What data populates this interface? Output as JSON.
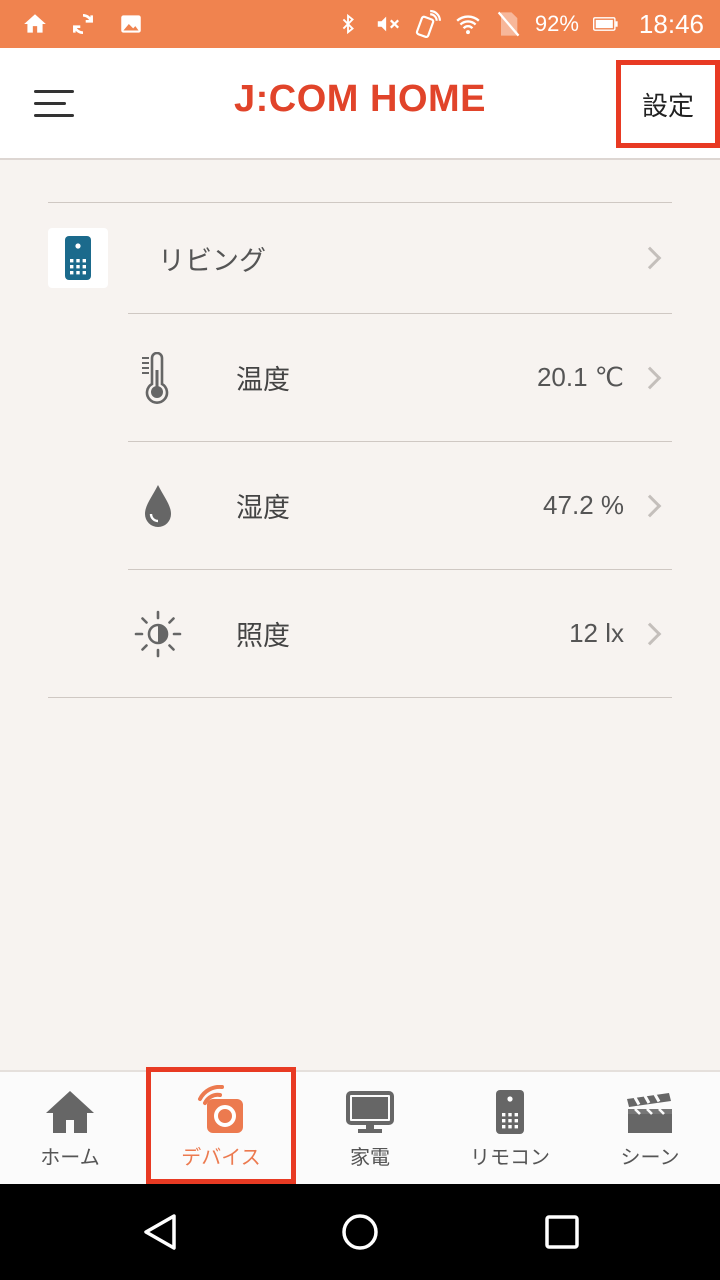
{
  "status_bar": {
    "battery": "92%",
    "time": "18:46"
  },
  "app_bar": {
    "title": "J:COM HOME",
    "settings_label": "設定"
  },
  "room": {
    "name": "リビング",
    "icon": "remote-device-icon"
  },
  "sensors": [
    {
      "label": "温度",
      "value": "20.1 ℃",
      "icon": "thermometer-icon"
    },
    {
      "label": "湿度",
      "value": "47.2 %",
      "icon": "water-drop-icon"
    },
    {
      "label": "照度",
      "value": "12 lx",
      "icon": "brightness-icon"
    }
  ],
  "bottom_nav": {
    "active": "devices",
    "items": [
      {
        "label": "ホーム",
        "icon": "home-icon"
      },
      {
        "label": "デバイス",
        "icon": "device-icon"
      },
      {
        "label": "家電",
        "icon": "monitor-icon"
      },
      {
        "label": "リモコン",
        "icon": "remote-icon"
      },
      {
        "label": "シーン",
        "icon": "clapperboard-icon"
      }
    ]
  },
  "colors": {
    "status_bar": "#f0834f",
    "brand": "#e1442a",
    "highlight": "#e83a23",
    "background": "#f7f3f0",
    "device_icon": "#1b6a8c"
  }
}
